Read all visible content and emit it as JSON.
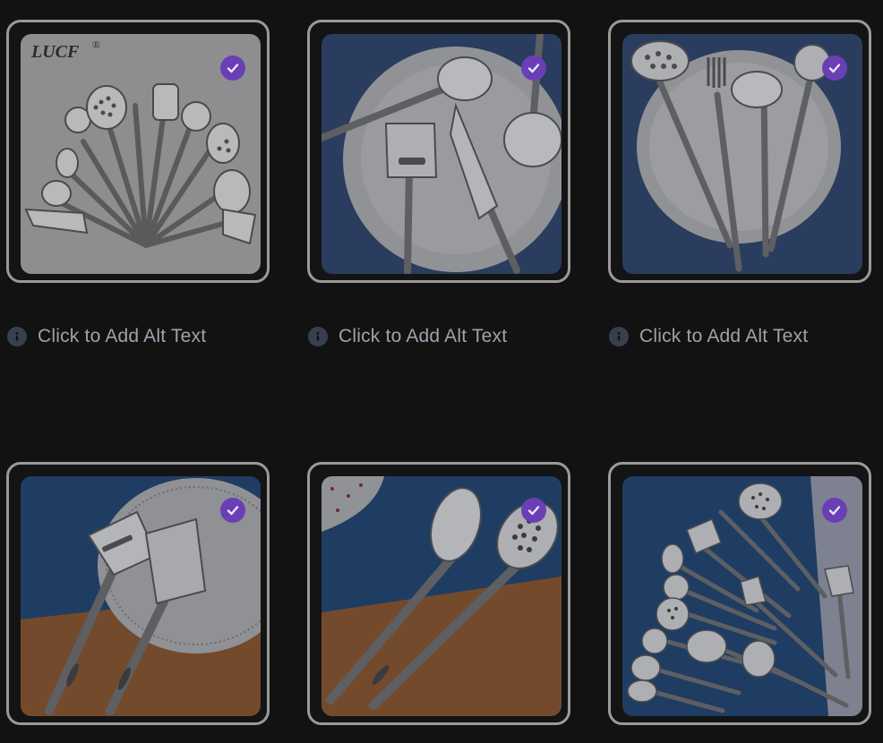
{
  "grid": {
    "items": [
      {
        "brand": "LUCF",
        "brand_mark": "®",
        "alt_label": "Click to Add Alt Text",
        "selected": true,
        "check_icon": "check-circle-icon",
        "info_icon": "info-icon"
      },
      {
        "alt_label": "Click to Add Alt Text",
        "selected": true,
        "check_icon": "check-circle-icon",
        "info_icon": "info-icon"
      },
      {
        "alt_label": "Click to Add Alt Text",
        "selected": true,
        "check_icon": "check-circle-icon",
        "info_icon": "info-icon"
      },
      {
        "selected": true,
        "check_icon": "check-circle-icon"
      },
      {
        "selected": true,
        "check_icon": "check-circle-icon"
      },
      {
        "selected": true,
        "check_icon": "check-circle-icon"
      }
    ]
  },
  "colors": {
    "background": "#121212",
    "card_border": "#9a9a9a",
    "check_badge": "#6a3fb6",
    "alt_text": "#9da3ae",
    "info_icon_bg": "#384050"
  }
}
